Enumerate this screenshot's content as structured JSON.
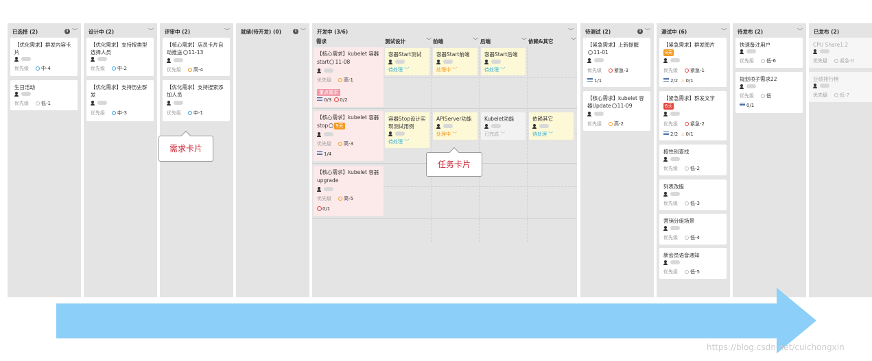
{
  "columns": {
    "selected": {
      "title": "已选择 (2)"
    },
    "designing": {
      "title": "设计中 (2)"
    },
    "reviewing": {
      "title": "评审中 (2)"
    },
    "ready": {
      "title": "就绪(待开发) (0)"
    },
    "developing": {
      "title": "开发中 (3/6)"
    },
    "to_test": {
      "title": "待测试 (2)"
    },
    "testing": {
      "title": "测试中 (6)"
    },
    "to_release": {
      "title": "待发布 (2)"
    },
    "released": {
      "title": "已发布 (2)"
    }
  },
  "labels": {
    "priority": "优先级"
  },
  "subcolumns": {
    "story": "需求",
    "test_design": "测试设计",
    "frontend": "前端",
    "backend": "后端",
    "deps": "依赖&其它"
  },
  "cards": {
    "selected": [
      {
        "title": "【优化需求】群发内容卡片",
        "priority": "中-4"
      },
      {
        "title": "生日活动",
        "priority": "低-1"
      }
    ],
    "designing": [
      {
        "title": "【优化需求】支持按类型选择人员",
        "priority": "中-2"
      },
      {
        "title": "【优化需求】支持历史群发",
        "priority": "中-3"
      }
    ],
    "reviewing": [
      {
        "title_a": "【核心需求】店员卡片自动推送",
        "date": "11-13",
        "priority": "高-4"
      },
      {
        "title": "【优化需求】支持搜索添加人员",
        "priority": "中-1"
      }
    ],
    "to_test": [
      {
        "title_a": "【紧急需求】上新提醒",
        "date": "11-01",
        "priority": "紧急-3",
        "sub": "1/1"
      },
      {
        "title_a": "【核心需求】kubelet 容器Update",
        "date": "11-09",
        "priority": "高-2"
      }
    ],
    "testing": [
      {
        "title": "【紧急需求】群发图片",
        "badge": "9天",
        "priority": "紧急-1",
        "sub": "2/2",
        "fire": "0/1"
      },
      {
        "title": "【紧急需求】群发文字",
        "badge": "6天",
        "priority": "紧急-2",
        "sub": "2/2",
        "fire": "0/1"
      },
      {
        "title": "按性别查找",
        "priority": "低-2"
      },
      {
        "title": "列表改版",
        "priority": "低-3"
      },
      {
        "title": "营销分组场景",
        "priority": "低-4"
      },
      {
        "title": "新会员语音通知",
        "priority": "低-5"
      }
    ],
    "to_release": [
      {
        "title": "快速备注用户",
        "priority": "低-6"
      },
      {
        "title": "规划项子需求22",
        "priority": "低",
        "sub": "0/1"
      }
    ],
    "released": [
      {
        "title": "CPU Share1.2",
        "priority": "紧急-0"
      },
      {
        "title": "业绩排行榜",
        "priority": "低-7"
      }
    ]
  },
  "dev": {
    "stories": [
      {
        "title_a": "【核心需求】kubelet 容器start",
        "date": "11-08",
        "priority": "高-1",
        "tag": "重点需求",
        "sub": "0/3",
        "blocked": "0/2"
      },
      {
        "title_a": "【核心需求】kubelet 容器stop",
        "badge": "9天",
        "priority": "高-3",
        "sub": "1/4"
      },
      {
        "title": "【核心需求】kubelet 容器upgrade",
        "priority": "高-5",
        "blocked": "0/1"
      }
    ],
    "tasks": {
      "r1_test": {
        "title": "容器Start测试",
        "status": "待处理"
      },
      "r1_front": {
        "title": "容器Start前端",
        "status": "处理中"
      },
      "r1_back": {
        "title": "容器Start后端",
        "status": "待处理"
      },
      "r2_test": {
        "title": "容器Stop设计实现测试用例",
        "status": "待处理"
      },
      "r2_front": {
        "title": "APIServer功能",
        "status": "处理中"
      },
      "r2_back": {
        "title": "Kubelet功能",
        "status": "已完成"
      },
      "r2_deps": {
        "title": "依赖其它",
        "status": "待处理"
      }
    }
  },
  "callouts": {
    "story_card": "需求卡片",
    "task_card": "任务卡片"
  },
  "watermark": "https://blog.csdn.net/cuichongxin",
  "colors": {
    "arrow": "#8ccff8",
    "column_bg": "#e4e4e4",
    "story_bg": "#fce9ea",
    "task_bg": "#fdf8d6",
    "badge_orange": "#f39a21",
    "badge_red": "#e8453c"
  }
}
